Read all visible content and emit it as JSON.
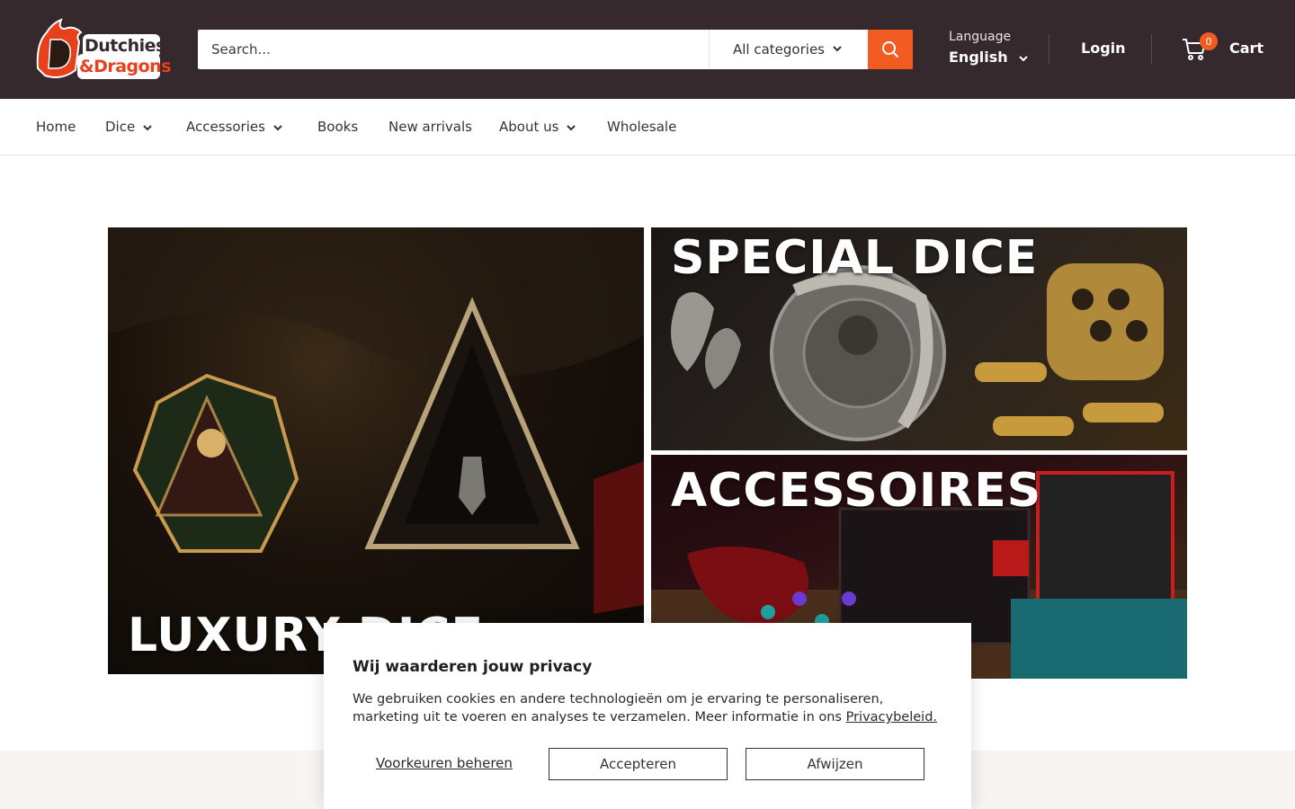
{
  "header": {
    "logo_line1": "Dutchies",
    "logo_line2": "&Dragons",
    "search_placeholder": "Search...",
    "category_select": "All categories",
    "language_caption": "Language",
    "language_value": "English",
    "login_label": "Login",
    "cart_count": "0",
    "cart_label": "Cart"
  },
  "nav": {
    "items": [
      {
        "label": "Home"
      },
      {
        "label": "Dice"
      },
      {
        "label": "Accessories"
      },
      {
        "label": "Books"
      },
      {
        "label": "New arrivals"
      },
      {
        "label": "About us"
      },
      {
        "label": "Wholesale"
      }
    ]
  },
  "banners": {
    "luxury": "LUXURY DICE",
    "special": "SPECIAL DICE",
    "accessories": "ACCESSOIRES"
  },
  "cookie": {
    "title": "Wij waarderen jouw privacy",
    "text": "We gebruiken cookies en andere technologieën om je ervaring te personaliseren, marketing uit te voeren en analyses te verzamelen. Meer informatie in ons ",
    "link": "Privacybeleid.",
    "preferences": "Voorkeuren beheren",
    "accept": "Accepteren",
    "reject": "Afwijzen"
  },
  "colors": {
    "header_bg": "#35292d",
    "accent": "#f25c23"
  }
}
